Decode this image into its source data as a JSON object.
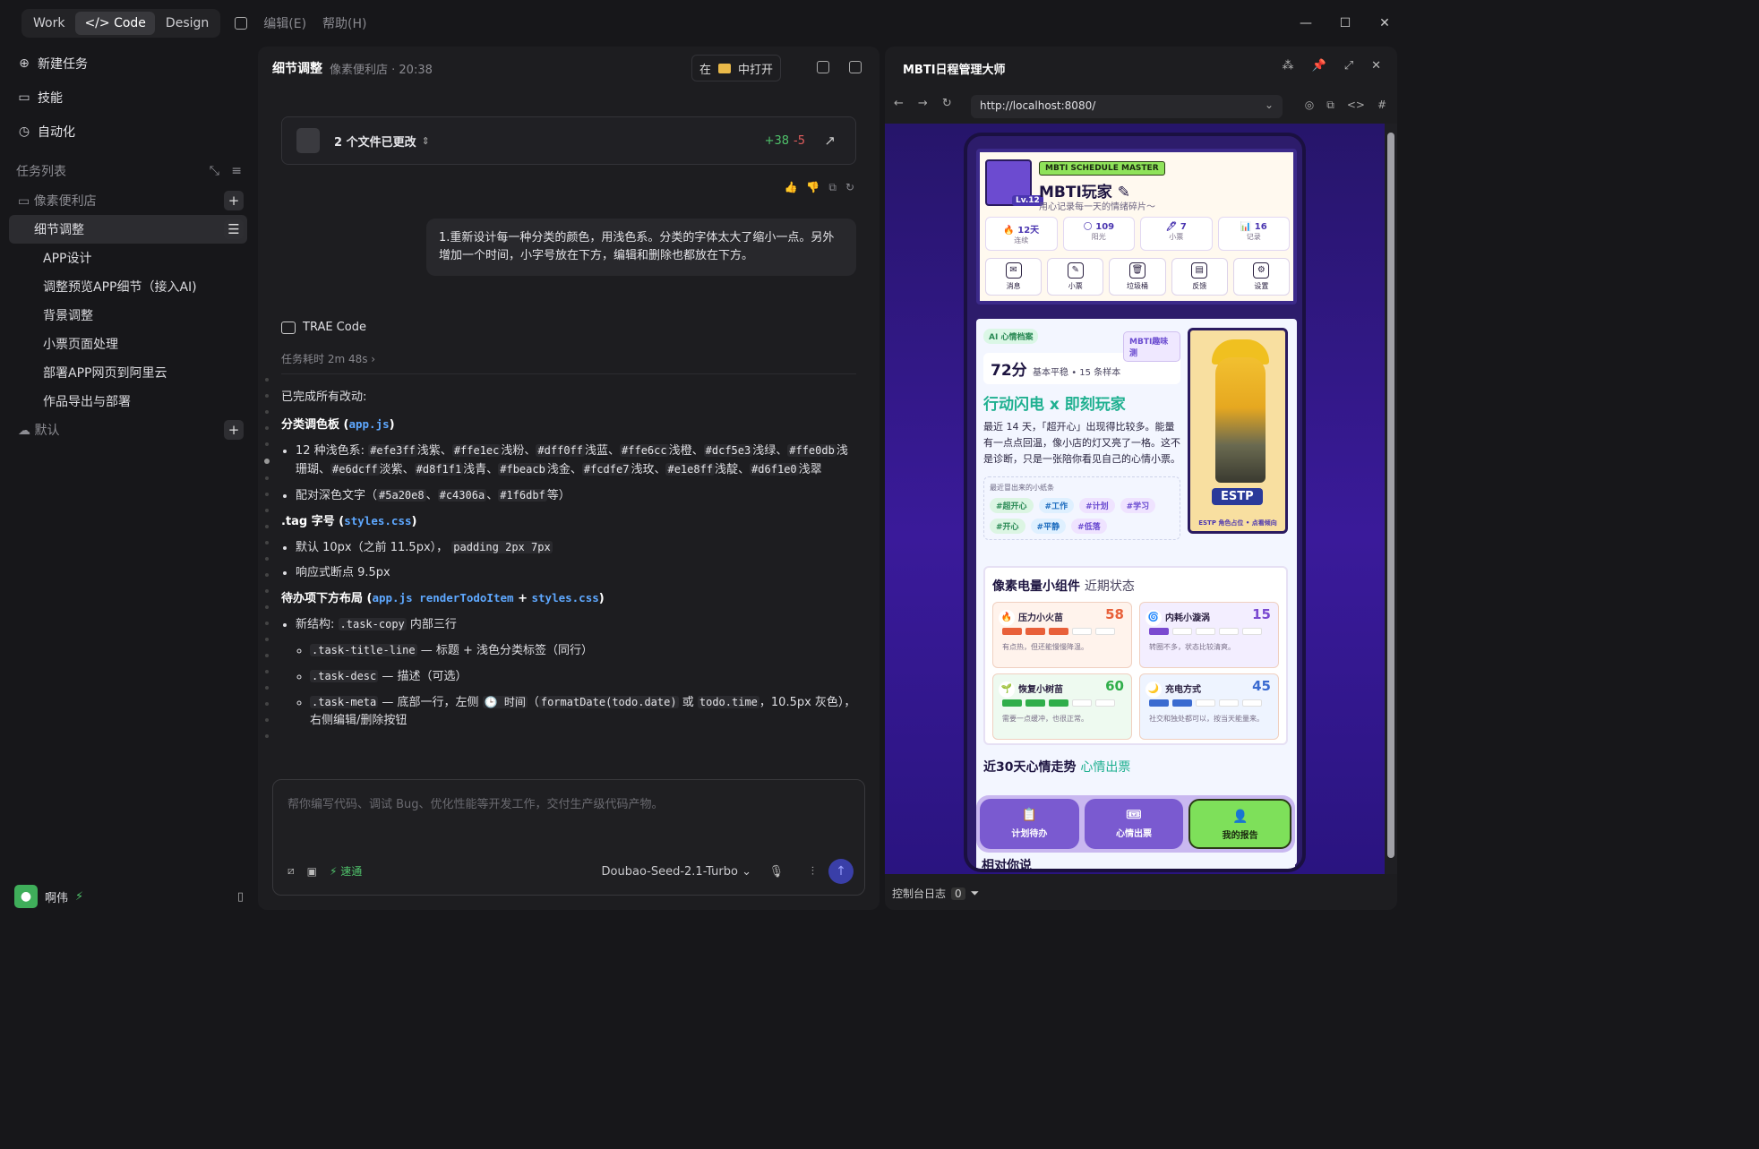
{
  "topbar": {
    "tabs": [
      "Work",
      "</> Code",
      "Design"
    ],
    "menus": [
      "编辑(E)",
      "帮助(H)"
    ]
  },
  "sidebar": {
    "items": [
      {
        "label": "新建任务"
      },
      {
        "label": "技能"
      },
      {
        "label": "自动化"
      }
    ],
    "task_list_title": "任务列表",
    "folder": "像素便利店",
    "tasks": [
      "细节调整",
      "APP设计",
      "调整预览APP细节（接入AI)",
      "背景调整",
      "小票页面处理",
      "部署APP网页到阿里云",
      "作品导出与部署"
    ],
    "default_folder": "默认",
    "user": "啊伟"
  },
  "chat": {
    "title": "细节调整",
    "subtitle": "像素便利店 · 20:38",
    "open_in": "在",
    "open_label": "中打开",
    "files_changed": "2 个文件已更改",
    "additions": "+38",
    "deletions": "-5",
    "user_message": "1.重新设计每一种分类的颜色，用浅色系。分类的字体太大了缩小一点。另外增加一个时间，小字号放在下方，编辑和删除也都放在下方。",
    "agent_name": "TRAE Code",
    "elapsed": "任务耗时 2m 48s",
    "done": "已完成所有改动:",
    "palette_title": "分类调色板",
    "palette_file": "app.js",
    "palette_line": "12 种浅色系:",
    "colors": [
      {
        "hex": "#efe3ff",
        "name": "浅紫"
      },
      {
        "hex": "#ffe1ec",
        "name": "浅粉"
      },
      {
        "hex": "#dff0ff",
        "name": "浅蓝"
      },
      {
        "hex": "#ffe6cc",
        "name": "浅橙"
      },
      {
        "hex": "#dcf5e3",
        "name": "浅绿"
      },
      {
        "hex": "#ffe0db",
        "name": "浅珊瑚"
      },
      {
        "hex": "#e6dcff",
        "name": "淡紫"
      },
      {
        "hex": "#d8f1f1",
        "name": "浅青"
      },
      {
        "hex": "#fbeacb",
        "name": "浅金"
      },
      {
        "hex": "#fcdfe7",
        "name": "浅玫"
      },
      {
        "hex": "#e1e8ff",
        "name": "浅靛"
      },
      {
        "hex": "#d6f1e0",
        "name": "浅翠"
      }
    ],
    "dark_text_pre": "配对深色文字（",
    "dark_codes": [
      "#5a20e8",
      "#c4306a",
      "#1f6dbf"
    ],
    "dark_text_post": "等）",
    "tag_title": ".tag 字号",
    "tag_file": "styles.css",
    "tag_default": "默认 10px（之前 11.5px），",
    "tag_padding": "padding 2px 7px",
    "tag_responsive": "响应式断点 9.5px",
    "layout_title": "待办项下方布局",
    "layout_files": "app.js renderTodoItem",
    "layout_plus": "+",
    "layout_css": "styles.css",
    "struct_label": "新结构:",
    "struct_code": ".task-copy",
    "struct_text": "内部三行",
    "sub1_code": ".task-title-line",
    "sub1_text": "— 标题 + 浅色分类标签（同行）",
    "sub2_code": ".task-desc",
    "sub2_text": "— 描述（可选）",
    "sub3_code": ".task-meta",
    "sub3_text_a": "— 底部一行，左侧",
    "sub3_time": "🕒 时间",
    "sub3_code2": "formatDate(todo.date)",
    "sub3_or": "或",
    "sub3_code3": "todo.time",
    "sub3_text_b": "，10.5px 灰色），右侧编辑/删除按钮",
    "input_placeholder": "帮你编写代码、调试 Bug、优化性能等开发工作，交付生产级代码产物。",
    "fast": "速通",
    "model": "Doubao-Seed-2.1-Turbo"
  },
  "browser": {
    "title": "MBTI日程管理大师",
    "url": "http://localhost:8080/",
    "console": "控制台日志",
    "console_count": "0"
  },
  "app": {
    "badge": "MBTI SCHEDULE MASTER",
    "name": "MBTI玩家 ✎",
    "tagline": "用心记录每一天的情绪碎片～",
    "level": "Lv.12",
    "stats": [
      {
        "value": "🔥 12天",
        "label": "连续"
      },
      {
        "value": "🌕 109",
        "label": "阳光"
      },
      {
        "value": "🖊 7",
        "label": "小票"
      },
      {
        "value": "📊 16",
        "label": "记录"
      }
    ],
    "quick": [
      {
        "label": "消息"
      },
      {
        "label": "小票"
      },
      {
        "label": "垃圾桶"
      },
      {
        "label": "反馈"
      },
      {
        "label": "设置"
      }
    ],
    "ai_chip": "AI 心情档案",
    "fun_chip": "MBTI趣味测",
    "score": "72分",
    "score_note": "基本平稳 • 15 条样本",
    "motto": "行动闪电 x 即刻玩家",
    "diary": "最近 14 天，「超开心」出现得比较多。能量有一点点回温，像小店的灯又亮了一格。这不是诊断，只是一张陪你看见自己的心情小票。",
    "tags_title": "最近冒出来的小纸条",
    "tags": [
      {
        "text": "#超开心",
        "color": "#2a8a55",
        "bg": "#dcf5e3"
      },
      {
        "text": "#工作",
        "color": "#1f6dbf",
        "bg": "#dff0ff"
      },
      {
        "text": "#计划",
        "color": "#6a4bd0",
        "bg": "#efe3ff"
      },
      {
        "text": "#学习",
        "color": "#6a4bd0",
        "bg": "#efe3ff"
      },
      {
        "text": "#开心",
        "color": "#2a8a55",
        "bg": "#dcf5e3"
      },
      {
        "text": "#平静",
        "color": "#1f6dbf",
        "bg": "#dff0ff"
      },
      {
        "text": "#低落",
        "color": "#6a4bd0",
        "bg": "#efe3ff"
      }
    ],
    "type": "ESTP",
    "type_caption": "ESTP 角色占位 • 点看倾向",
    "widget_title": "像素电量小组件",
    "widget_sub": "近期状态",
    "cells": [
      {
        "name": "压力小火苗",
        "value": "58",
        "desc": "有点热，但还能慢慢降温。",
        "color": "#e8603a",
        "bg": "#fff3ec",
        "fill": 3
      },
      {
        "name": "内耗小漩涡",
        "value": "15",
        "desc": "转圈不多，状态比较清爽。",
        "color": "#7a4ad0",
        "bg": "#f3eeff",
        "fill": 1
      },
      {
        "name": "恢复小树苗",
        "value": "60",
        "desc": "需要一点缓冲，也很正常。",
        "color": "#2fae4a",
        "bg": "#eefaf0",
        "fill": 3
      },
      {
        "name": "充电方式",
        "value": "45",
        "desc": "社交和独处都可以，按当天能量来。",
        "color": "#3a6ad0",
        "bg": "#eef4ff",
        "fill": 2
      }
    ],
    "trend_title": "近30天心情走势",
    "trend_sub": "心情出票",
    "tabs": [
      {
        "label": "计划待办",
        "icon": "📋"
      },
      {
        "label": "心情出票",
        "icon": "🎟"
      },
      {
        "label": "我的报告",
        "icon": "👤"
      }
    ],
    "peek": "相对你说"
  }
}
